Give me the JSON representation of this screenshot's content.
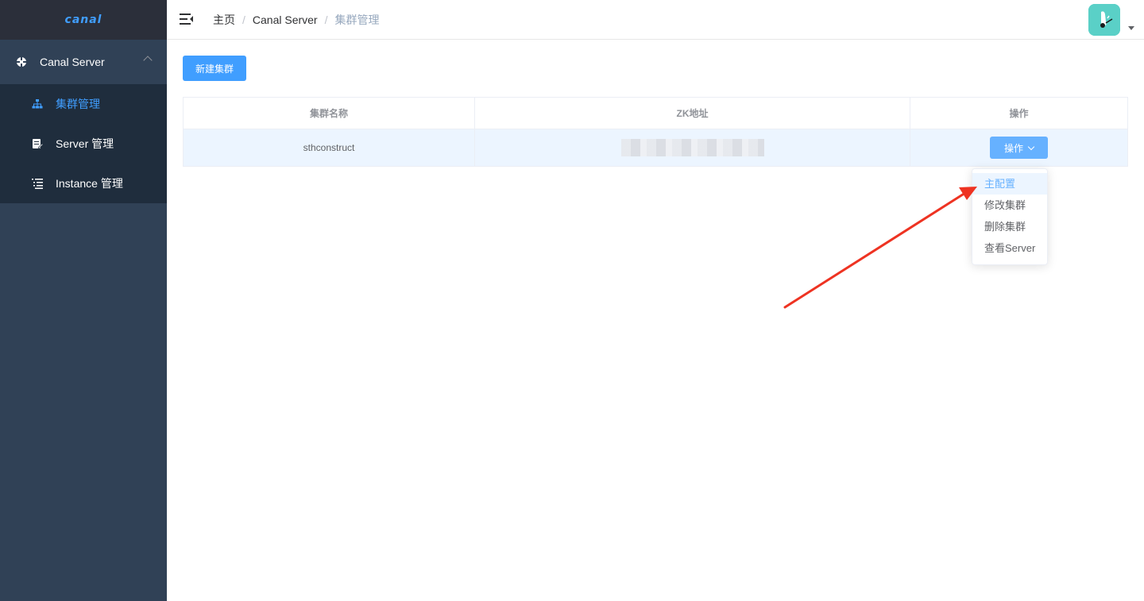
{
  "app": {
    "logo_text": "canal"
  },
  "sidebar": {
    "parent_label": "Canal Server",
    "items": [
      {
        "label": "集群管理",
        "icon": "sitemap-icon",
        "active": true
      },
      {
        "label": "Server 管理",
        "icon": "edit-doc-icon",
        "active": false
      },
      {
        "label": "Instance 管理",
        "icon": "list-icon",
        "active": false
      }
    ]
  },
  "breadcrumb": [
    "主页",
    "Canal Server",
    "集群管理"
  ],
  "toolbar": {
    "new_cluster_label": "新建集群"
  },
  "table": {
    "headers": [
      "集群名称",
      "ZK地址",
      "操作"
    ],
    "rows": [
      {
        "name": "sthconstruct",
        "zk_address": "",
        "action_label": "操作"
      }
    ]
  },
  "dropdown": {
    "items": [
      "主配置",
      "修改集群",
      "删除集群",
      "查看Server"
    ]
  },
  "colors": {
    "primary": "#409eff",
    "sidebar_bg": "#304156",
    "annotation_arrow": "#ee3322"
  }
}
